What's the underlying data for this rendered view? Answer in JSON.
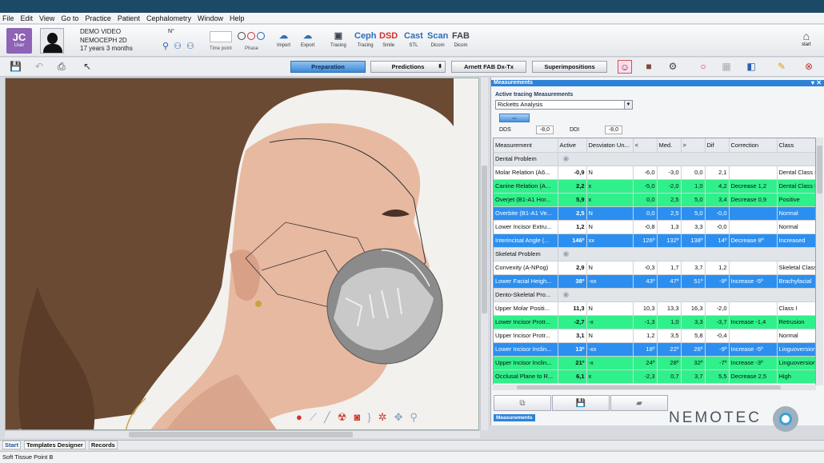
{
  "menu": [
    "File",
    "Edit",
    "View",
    "Go to",
    "Practice",
    "Patient",
    "Cephalometry",
    "Window",
    "Help"
  ],
  "patient": {
    "initials": "JC",
    "initials_sub": "User",
    "name": "DEMO VIDEO",
    "case": "NEMOCEPH 2D",
    "age": "17 years 3 months",
    "number_label": "N°"
  },
  "time_point_label": "Time point",
  "phase_label": "Phase",
  "tools": [
    {
      "name": "import",
      "icon": "☁",
      "label": "Import",
      "color": "blue"
    },
    {
      "name": "export",
      "icon": "☁",
      "label": "Export",
      "color": "blue"
    },
    {
      "name": "tracing",
      "icon": "▣",
      "label": "Tracing",
      "color": "dark"
    },
    {
      "name": "ceph",
      "icon": "Ceph",
      "label": "Tracing",
      "color": "blue"
    },
    {
      "name": "dsd",
      "icon": "DSD",
      "label": "Smile",
      "color": "red"
    },
    {
      "name": "cast",
      "icon": "Cast",
      "label": "STL",
      "color": "blue"
    },
    {
      "name": "scan",
      "icon": "Scan",
      "label": "Dicom",
      "color": "blue"
    },
    {
      "name": "fab",
      "icon": "FAB",
      "label": "Dicom",
      "color": "dark"
    }
  ],
  "start_label": "start",
  "toolbar2": {
    "preparation": "Preparation",
    "predictions": "Predictions",
    "arnett": "Arnett FAB Dx-Tx",
    "superimpositions": "Superimpositions"
  },
  "panel": {
    "title": "Measurements",
    "subtitle": "Active tracing Measurements",
    "analysis": "Ricketts Analysis",
    "swap_icon": "⇔",
    "dds_label": "DDS",
    "dds_value": "-8,0",
    "ddi_label": "DDI",
    "ddi_value": "-8,0",
    "tab": "Measurements"
  },
  "table": {
    "headers": [
      "Measurement",
      "Active",
      "Desviaton Un...",
      "<",
      "Med.",
      ">",
      "Dif",
      "Correction",
      "Class"
    ],
    "rows": [
      {
        "type": "section",
        "label": "Dental Problem"
      },
      {
        "type": "white",
        "cells": [
          "Molar Relation (A6...",
          "-0,9",
          "N",
          "-6,0",
          "-3,0",
          "0,0",
          "2,1",
          "",
          "Dental Class I"
        ]
      },
      {
        "type": "green",
        "cells": [
          "Canine Relation (A...",
          "2,2",
          "x",
          "-5,0",
          "-2,0",
          "1,0",
          "4,2",
          "Decrease 1,2",
          "Dental Class II"
        ]
      },
      {
        "type": "green",
        "cells": [
          "Overjet (B1-A1 Hor...",
          "5,9",
          "x",
          "0,0",
          "2,5",
          "5,0",
          "3,4",
          "Decrease 0,9",
          "Positive"
        ]
      },
      {
        "type": "blue",
        "cells": [
          "Overbite (B1-A1 Ve...",
          "2,5",
          "N",
          "0,0",
          "2,5",
          "5,0",
          "-0,0",
          "",
          "Normal"
        ]
      },
      {
        "type": "white",
        "cells": [
          "Lower Incisor Extru...",
          "1,2",
          "N",
          "-0,8",
          "1,3",
          "3,3",
          "-0,0",
          "",
          "Normal"
        ]
      },
      {
        "type": "blue",
        "cells": [
          "Interincisal Angle (...",
          "146º",
          "xx",
          "126º",
          "132º",
          "138º",
          "14º",
          "Decrease  8º",
          "Increased"
        ]
      },
      {
        "type": "section",
        "label": "Skeletal Problem"
      },
      {
        "type": "white",
        "cells": [
          "Convexity (A-NPog)",
          "2,9",
          "N",
          "-0,3",
          "1,7",
          "3,7",
          "1,2",
          "",
          "Skeletal Class I"
        ]
      },
      {
        "type": "blue",
        "cells": [
          "Lower Facial Heigh...",
          "38º",
          "-xx",
          "43º",
          "47º",
          "51º",
          "-9º",
          "Increase -5º",
          "Brachyfacial"
        ]
      },
      {
        "type": "section",
        "label": "Dento-Skeletal Pro..."
      },
      {
        "type": "white",
        "cells": [
          "Upper Molar Positi...",
          "11,3",
          "N",
          "10,3",
          "13,3",
          "16,3",
          "-2,0",
          "",
          "Class I"
        ]
      },
      {
        "type": "green",
        "cells": [
          "Lower Incisor Protr...",
          "-2,7",
          "-x",
          "-1,3",
          "1,0",
          "3,3",
          "-3,7",
          "Increase -1,4",
          "Retrusion"
        ]
      },
      {
        "type": "white",
        "cells": [
          "Upper Incisor Protr...",
          "3,1",
          "N",
          "1,2",
          "3,5",
          "5,8",
          "-0,4",
          "",
          "Normal"
        ]
      },
      {
        "type": "blue",
        "cells": [
          "Lower Incisor Inclin...",
          "13º",
          "-xx",
          "18º",
          "22º",
          "26º",
          "-9º",
          "Increase -5º",
          "Linguoversion"
        ]
      },
      {
        "type": "green",
        "cells": [
          "Upper Incisor Inclin...",
          "21º",
          "-x",
          "24º",
          "28º",
          "32º",
          "-7º",
          "Increase -3º",
          "Linguoversion"
        ]
      },
      {
        "type": "green",
        "cells": [
          "Occlusal Plane to R...",
          "6,1",
          "x",
          "-2,3",
          "0,7",
          "3,7",
          "5,5",
          "Decrease 2,5",
          "High"
        ]
      }
    ]
  },
  "brand": "NEMOTEC",
  "bottom_tabs": [
    "Start",
    "Templates Designer",
    "Records"
  ],
  "status": "Soft Tissue Point B",
  "colors": {
    "accent": "#2e82d6",
    "green_row": "#2ff08a",
    "blue_row": "#2c8ff0",
    "avatar": "#8f63b5"
  }
}
